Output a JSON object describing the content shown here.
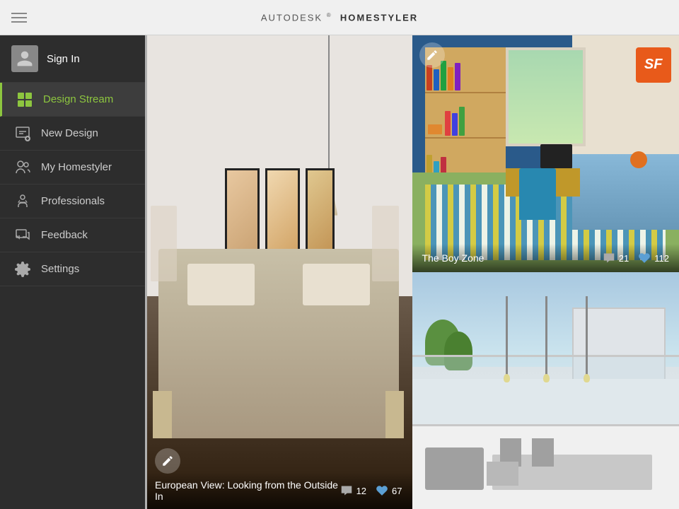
{
  "header": {
    "title_prefix": "AUTODESK",
    "title_suffix": "HOMESTYLER",
    "trademark": "®",
    "menu_icon": "menu-icon"
  },
  "sidebar": {
    "sign_in_label": "Sign In",
    "nav_items": [
      {
        "id": "design-stream",
        "label": "Design Stream",
        "active": true
      },
      {
        "id": "new-design",
        "label": "New Design",
        "active": false
      },
      {
        "id": "my-homestyler",
        "label": "My Homestyler",
        "active": false
      },
      {
        "id": "professionals",
        "label": "Professionals",
        "active": false
      },
      {
        "id": "feedback",
        "label": "Feedback",
        "active": false
      },
      {
        "id": "settings",
        "label": "Settings",
        "active": false
      }
    ]
  },
  "designs": {
    "tile1": {
      "title": "European View: Looking from the Outside In",
      "comments": "12",
      "likes": "67"
    },
    "tile2": {
      "title": "The Boy Zone",
      "comments": "21",
      "likes": "112"
    },
    "tile3": {
      "title": "",
      "comments": "",
      "likes": ""
    }
  },
  "colors": {
    "green_accent": "#8dc63f",
    "sidebar_bg": "#2d2d2d",
    "header_bg": "#f0f0f0"
  }
}
